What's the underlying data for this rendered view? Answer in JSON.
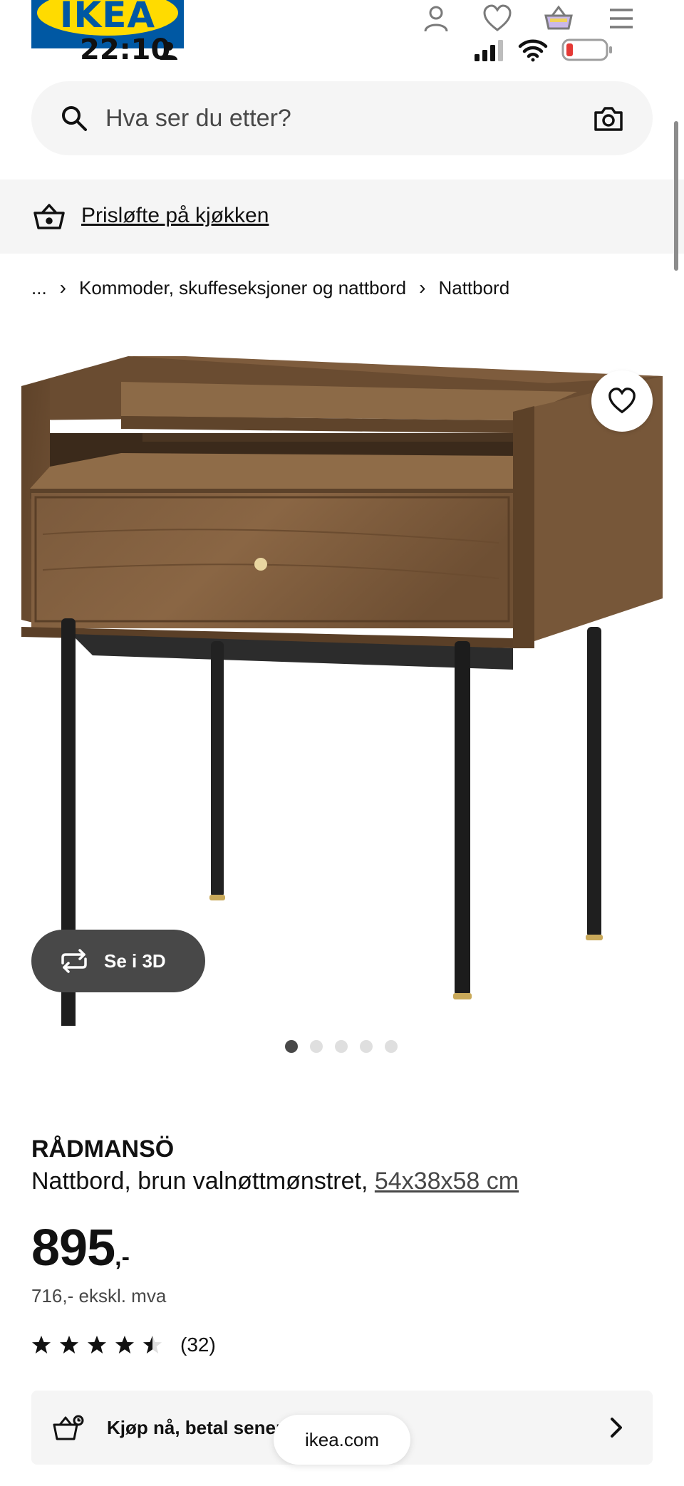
{
  "header": {
    "logo_text": "IKEA",
    "brand_colors": {
      "blue": "#0058a3",
      "yellow": "#ffdb00"
    },
    "status_time": "22:10",
    "icons": [
      "person-icon",
      "heart-icon",
      "basket-icon",
      "menu-icon"
    ]
  },
  "search": {
    "placeholder": "Hva ser du etter?",
    "icons": [
      "search-icon",
      "camera-icon"
    ]
  },
  "promo": {
    "label": "Prisløfte på kjøkken"
  },
  "breadcrumb": {
    "items": [
      "...",
      "Kommoder, skuffeseksjoner og nattbord",
      "Nattbord"
    ]
  },
  "gallery": {
    "view_3d_label": "Se i 3D",
    "dot_count": 5,
    "active_index": 0
  },
  "product": {
    "name": "RÅDMANSÖ",
    "description": "Nattbord, brun valnøttmønstret,",
    "dimensions": "54x38x58 cm",
    "price_integer": "895",
    "price_decimal": ",-",
    "price_excl_vat": "716,- ekskl. mva",
    "rating": 4.5,
    "rating_max": 5,
    "review_count": "(32)"
  },
  "bnpl": {
    "label": "Kjøp nå, betal senere"
  },
  "browser": {
    "url_label": "ikea.com"
  }
}
